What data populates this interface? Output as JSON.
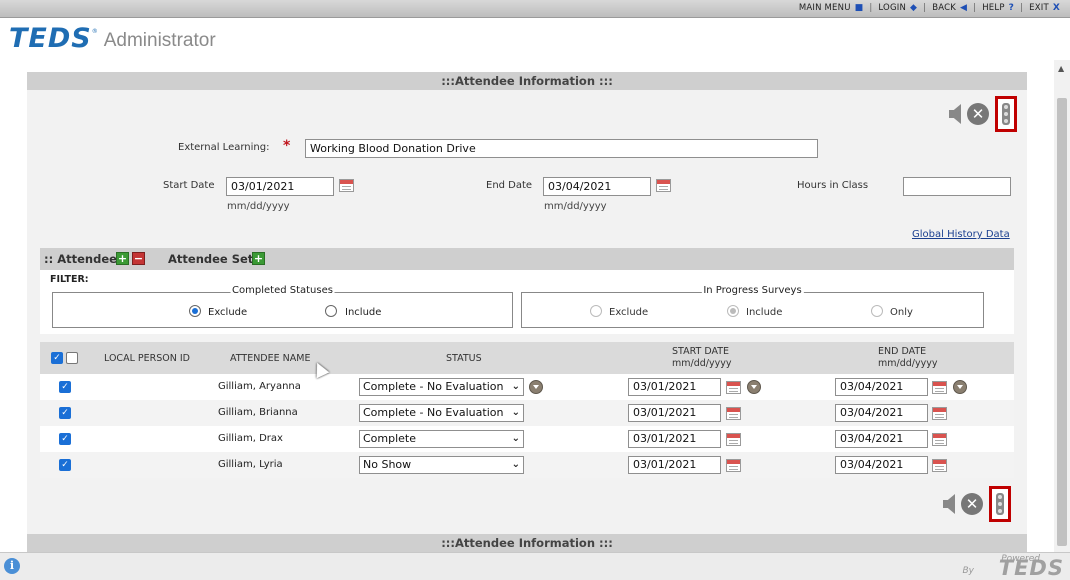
{
  "topnav": {
    "items": [
      {
        "label": "MAIN MENU",
        "icon": "■"
      },
      {
        "label": "LOGIN",
        "icon": "◆"
      },
      {
        "label": "BACK",
        "icon": "◀"
      },
      {
        "label": "HELP",
        "icon": "?"
      },
      {
        "label": "EXIT",
        "icon": "X"
      }
    ]
  },
  "header": {
    "logo": "TEDS",
    "logo_mark": "®",
    "subtitle": "Administrator"
  },
  "section": {
    "title_top": ":::Attendee Information :::",
    "title_bottom": ":::Attendee Information :::"
  },
  "form": {
    "external_learning_label": "External Learning:",
    "required_mark": "*",
    "external_learning_value": "Working Blood Donation Drive",
    "start_date_label": "Start Date",
    "start_date_value": "03/01/2021",
    "start_date_hint": "mm/dd/yyyy",
    "end_date_label": "End Date",
    "end_date_value": "03/04/2021",
    "end_date_hint": "mm/dd/yyyy",
    "hours_label": "Hours in Class",
    "hours_value": "",
    "global_history_link": "Global History Data"
  },
  "attendee_bar": {
    "attendee_label": ":: Attendee",
    "attendee_set_label": "Attendee Set"
  },
  "filter": {
    "label": "FILTER:",
    "completed": {
      "legend": "Completed Statuses",
      "options": [
        {
          "label": "Exclude",
          "selected": true
        },
        {
          "label": "Include",
          "selected": false
        }
      ]
    },
    "in_progress": {
      "legend": "In Progress Surveys",
      "options": [
        {
          "label": "Exclude",
          "selected": false
        },
        {
          "label": "Include",
          "selected": true
        },
        {
          "label": "Only",
          "selected": false
        }
      ]
    }
  },
  "grid": {
    "headers": {
      "local_person_id": "LOCAL PERSON ID",
      "attendee_name": "ATTENDEE NAME",
      "status": "STATUS",
      "start_date": "START DATE",
      "start_date_fmt": "mm/dd/yyyy",
      "end_date": "END DATE",
      "end_date_fmt": "mm/dd/yyyy"
    },
    "rows": [
      {
        "checked": true,
        "local_id": "",
        "name": "Gilliam, Aryanna",
        "status": "Complete - No Evaluation",
        "start": "03/01/2021",
        "end": "03/04/2021"
      },
      {
        "checked": true,
        "local_id": "",
        "name": "Gilliam, Brianna",
        "status": "Complete - No Evaluation",
        "start": "03/01/2021",
        "end": "03/04/2021"
      },
      {
        "checked": true,
        "local_id": "",
        "name": "Gilliam, Drax",
        "status": "Complete",
        "start": "03/01/2021",
        "end": "03/04/2021"
      },
      {
        "checked": true,
        "local_id": "",
        "name": "Gilliam, Lyria",
        "status": "No Show",
        "start": "03/01/2021",
        "end": "03/04/2021"
      }
    ]
  },
  "footer": {
    "powered": "Powered",
    "by": "By",
    "logo": "TEDS"
  },
  "colors": {
    "accent_blue": "#1f6db3",
    "highlight_red": "#c00000",
    "required_red": "#c0141c",
    "checkbox_blue": "#1a6fd6"
  }
}
